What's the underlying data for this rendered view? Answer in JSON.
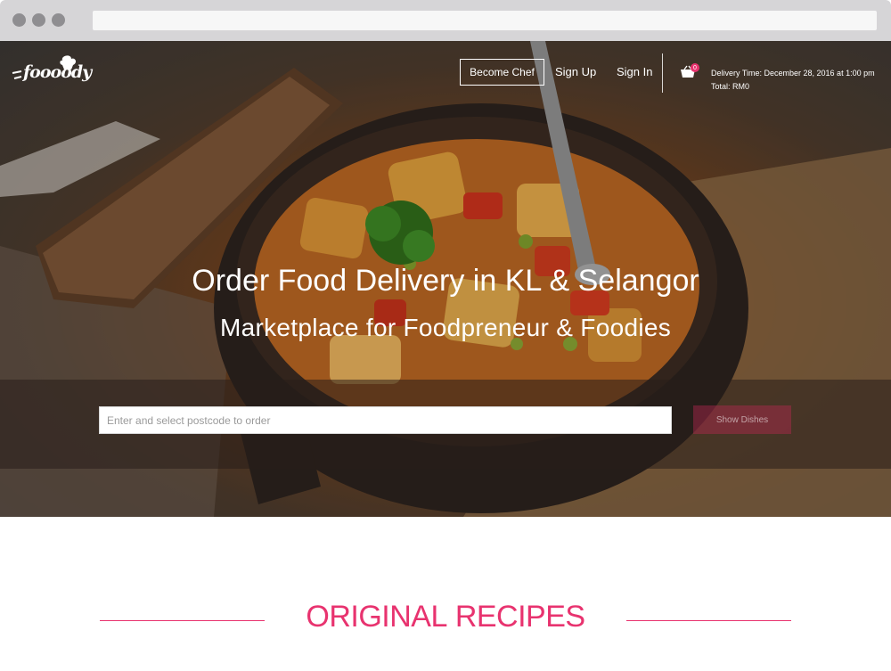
{
  "brand": {
    "logo_text": "foooody",
    "accent": "#e8336f"
  },
  "nav": {
    "become_chef": "Become Chef",
    "sign_up": "Sign Up",
    "sign_in": "Sign In",
    "cart_count": "0",
    "delivery_time": "Delivery Time: December 28, 2016 at 1:00 pm",
    "total": "Total: RM0"
  },
  "hero": {
    "headline": "Order Food Delivery in KL & Selangor",
    "subheadline": "Marketplace for Foodpreneur & Foodies",
    "postcode_placeholder": "Enter and select postcode to order",
    "show_dishes": "Show Dishes"
  },
  "section": {
    "title_bold": "ORIGINAL",
    "title_light": " RECIPES"
  }
}
